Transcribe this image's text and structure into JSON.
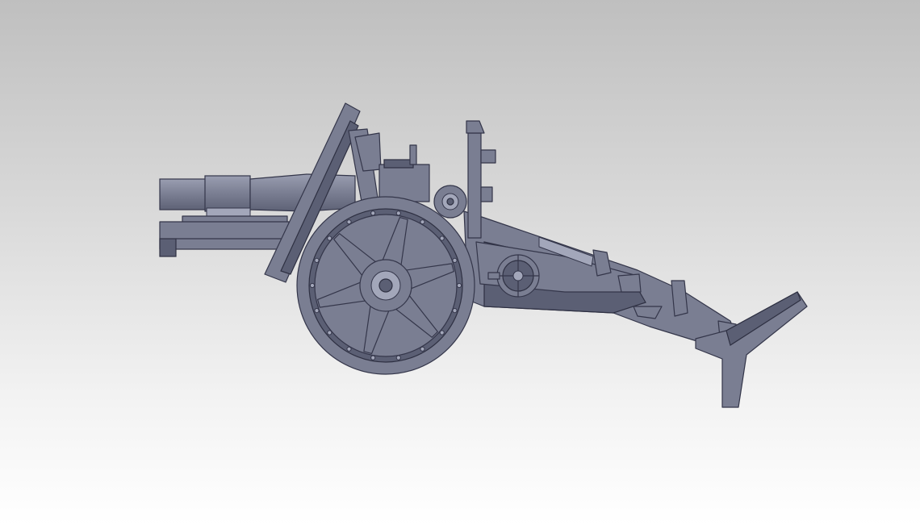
{
  "viewport": {
    "background_top": "#bfbfbf",
    "background_bottom": "#ffffff",
    "model_color": "#7a7e92",
    "edge_color": "#34364a"
  },
  "model": {
    "icon": "field-howitzer-3d-model"
  }
}
